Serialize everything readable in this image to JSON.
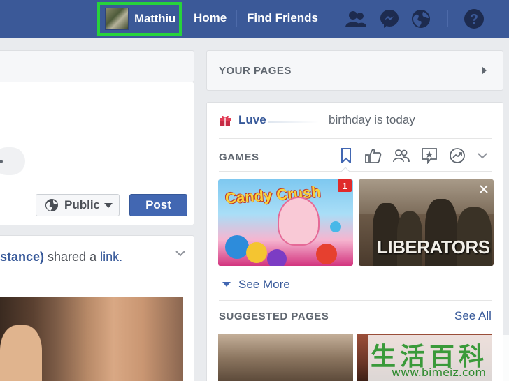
{
  "topbar": {
    "profile_name": "Matthiu",
    "home_label": "Home",
    "find_friends_label": "Find Friends",
    "icons": [
      "friend-requests-icon",
      "messenger-icon",
      "notifications-globe-icon",
      "help-icon"
    ]
  },
  "composer": {
    "privacy_label": "Public",
    "post_label": "Post"
  },
  "feed": {
    "author_fragment": "stance)",
    "action_text": " shared a ",
    "link_text": "link."
  },
  "sidebar": {
    "your_pages_title": "YOUR PAGES",
    "birthday": {
      "name": "Luve",
      "text": "birthday is today"
    },
    "games": {
      "title": "GAMES",
      "tabs": [
        "bookmark-icon",
        "like-icon",
        "friends-icon",
        "featured-icon",
        "trending-icon",
        "chevron-down-icon"
      ],
      "tiles": [
        {
          "name": "Candy Crush Saga",
          "title": "Candy Crush",
          "badge": "1"
        },
        {
          "name": "Liberators",
          "title": "LIBERATORS"
        }
      ],
      "see_more_label": "See More"
    },
    "suggested_pages": {
      "title": "SUGGESTED PAGES",
      "see_all_label": "See All"
    }
  },
  "watermark": {
    "chars": "生活百科",
    "url": "www.bimeiz.com"
  },
  "colors": {
    "topbar": "#3b5998",
    "highlight": "#27d33b",
    "link": "#365899",
    "post_button": "#4267b2"
  }
}
